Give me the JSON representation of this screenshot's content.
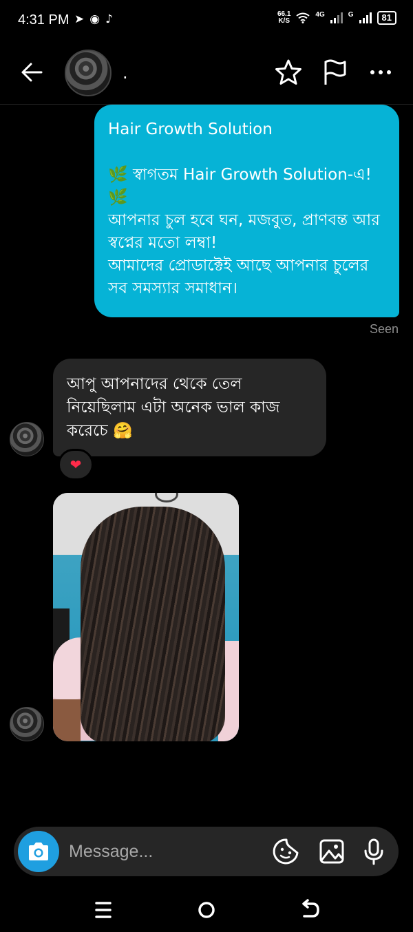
{
  "status": {
    "time": "4:31 PM",
    "app_icons": [
      "send-icon",
      "messenger-icon",
      "tiktok-icon"
    ],
    "speed_value": "66.1",
    "speed_unit": "K/S",
    "network_1": "4G",
    "network_2": "G",
    "battery": "81"
  },
  "header": {
    "contact_name": "."
  },
  "sent_message": {
    "title": "Hair Growth Solution",
    "body": "🌿 স্বাগতম Hair Growth Solution-এ! 🌿\nআপনার চুল হবে ঘন, মজবুত, প্রাণবন্ত আর স্বপ্নের মতো লম্বা!\nআমাদের প্রোডাক্টেই আছে আপনার চুলের সব সমস্যার সমাধান।",
    "status": "Seen"
  },
  "received_message": {
    "text": "আপু আপনাদের থেকে তেল নিয়েছিলাম এটা অনেক ভাল কাজ করেচে 🤗",
    "reaction": "❤"
  },
  "composer": {
    "placeholder": "Message..."
  },
  "colors": {
    "sent_bubble": "#06b3d6",
    "received_bubble": "#262626",
    "camera_button": "#1f9fe0",
    "background": "#000000"
  }
}
